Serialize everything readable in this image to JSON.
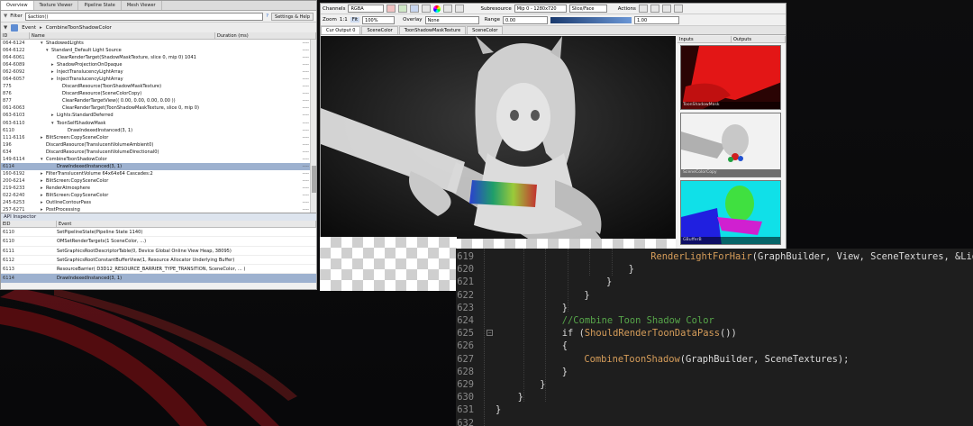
{
  "left_panel": {
    "tabs": [
      "Overview",
      "Texture Viewer",
      "Pipeline State",
      "Mesh Viewer"
    ],
    "filter_label": "Filter",
    "filter_value": "$action()",
    "filter_buttons": [
      "Settings & Help"
    ],
    "bar_label": "Event",
    "bar_text": "CombineToonShadowColor",
    "columns": [
      "ID",
      "Name",
      "Duration (ms)"
    ],
    "events": [
      {
        "id": "064-6124",
        "name": "ShadowedLights",
        "indent": 2,
        "arrow": "▾",
        "dur": "----"
      },
      {
        "id": "064-6122",
        "name": "Standard_Default Light Source",
        "indent": 3,
        "arrow": "▾",
        "dur": "----"
      },
      {
        "id": "064-6061",
        "name": "ClearRenderTarget(ShadowMaskTexture, slice 0, mip 0) 1041",
        "indent": 4,
        "arrow": "",
        "dur": "----"
      },
      {
        "id": "064-6089",
        "name": "ShadowProjectionOnOpaque",
        "indent": 4,
        "arrow": "▸",
        "dur": "----"
      },
      {
        "id": "062-6092",
        "name": "InjectTranslucencyLightArray",
        "indent": 4,
        "arrow": "▸",
        "dur": "----"
      },
      {
        "id": "064-6057",
        "name": "InjectTranslucencyLightArray",
        "indent": 4,
        "arrow": "▸",
        "dur": "----"
      },
      {
        "id": "775",
        "name": "DiscardResource(ToonShadowMaskTexture)",
        "indent": 5,
        "arrow": "",
        "dur": "----"
      },
      {
        "id": "876",
        "name": "DiscardResource(SceneColorCopy)",
        "indent": 5,
        "arrow": "",
        "dur": "----"
      },
      {
        "id": "877",
        "name": "ClearRenderTargetView(( 0.00, 0.00, 0.00, 0.00 ))",
        "indent": 5,
        "arrow": "",
        "dur": "----"
      },
      {
        "id": "061-6063",
        "name": "ClearRenderTarget(ToonShadowMaskTexture, slice 0, mip 0)",
        "indent": 5,
        "arrow": "",
        "dur": "----"
      },
      {
        "id": "063-6103",
        "name": "Lights:StandardDeferred",
        "indent": 4,
        "arrow": "▸",
        "dur": "----"
      },
      {
        "id": "063-6110",
        "name": "ToonSelfShadowMask",
        "indent": 4,
        "arrow": "▾",
        "dur": "----"
      },
      {
        "id": "6110",
        "name": "DrawIndexedInstanced(3, 1)",
        "indent": 6,
        "arrow": "",
        "dur": "----"
      },
      {
        "id": "111-6116",
        "name": "BlitScreen:CopySceneColor",
        "indent": 2,
        "arrow": "▸",
        "dur": "----"
      },
      {
        "id": "196",
        "name": "DiscardResource(TranslucentVolumeAmbient0)",
        "indent": 2,
        "arrow": "",
        "dur": "----"
      },
      {
        "id": "634",
        "name": "DiscardResource(TranslucentVolumeDirectional0)",
        "indent": 2,
        "arrow": "",
        "dur": "----"
      },
      {
        "id": "149-6114",
        "name": "CombineToonShadowColor",
        "indent": 2,
        "arrow": "▾",
        "dur": "----"
      },
      {
        "id": "6114",
        "name": "DrawIndexedInstanced(3, 1)",
        "indent": 4,
        "arrow": "",
        "dur": "----",
        "selected": true
      },
      {
        "id": "160-6192",
        "name": "FilterTranslucentVolume 64x64x64 Cascades:2",
        "indent": 2,
        "arrow": "▸",
        "dur": "----"
      },
      {
        "id": "200-6214",
        "name": "BlitScreen:CopySceneColor",
        "indent": 2,
        "arrow": "▸",
        "dur": "----"
      },
      {
        "id": "219-6233",
        "name": "RenderAtmosphere",
        "indent": 2,
        "arrow": "▸",
        "dur": "----"
      },
      {
        "id": "022-6240",
        "name": "BlitScreen:CopySceneColor",
        "indent": 2,
        "arrow": "▸",
        "dur": "----"
      },
      {
        "id": "245-6253",
        "name": "OutlineContourPass",
        "indent": 2,
        "arrow": "▸",
        "dur": "----"
      },
      {
        "id": "257-6271",
        "name": "PostProcessing",
        "indent": 2,
        "arrow": "▸",
        "dur": "----"
      }
    ],
    "inspector_title": "API Inspector",
    "inspector_columns": [
      "EID",
      "Event"
    ],
    "inspector_rows": [
      {
        "eid": "6110",
        "event": "SetPipelineState(Pipeline State 1140)",
        "selected": false
      },
      {
        "eid": "6110",
        "event": "OMSetRenderTargets(1 SceneColor, ...)",
        "selected": false
      },
      {
        "eid": "6111",
        "event": "SetGraphicsRootDescriptorTable(0, Device Global Online View Heap, 38095)",
        "selected": false
      },
      {
        "eid": "6112",
        "event": "SetGraphicsRootConstantBufferView(1, Resource Allocator Underlying Buffer)",
        "selected": false
      },
      {
        "eid": "6113",
        "event": "ResourceBarrier( D3D12_RESOURCE_BARRIER_TYPE_TRANSITION, SceneColor, ... )",
        "selected": false
      },
      {
        "eid": "6114",
        "event": "DrawIndexedInstanced(3, 1)",
        "selected": true
      }
    ]
  },
  "texture_viewer": {
    "toolbar1": {
      "channels_label": "Channels",
      "channels_value": "RGBA",
      "subresource_label": "Subresource",
      "subresource_value": "Mip 0 - 1280x720",
      "slice_value": "Slice/Face",
      "actions_label": "Actions"
    },
    "toolbar2": {
      "zoom_label": "Zoom",
      "zoom_value": "1:1",
      "fit_label": "Fit",
      "zoom_pct": "100%",
      "overlay_label": "Overlay",
      "overlay_value": "None",
      "range_label": "Range",
      "range_min": "0.00",
      "range_max": "1.00"
    },
    "tabs": [
      "Cur Output 0",
      "SceneColor",
      "ToonShadowMaskTexture",
      "SceneColor"
    ],
    "io_columns": [
      "Inputs",
      "Outputs"
    ],
    "thumbnails": [
      {
        "caption": "ToonShadowMask",
        "kind": "red"
      },
      {
        "caption": "SceneColorCopy",
        "kind": "white"
      },
      {
        "caption": "GBufferB",
        "kind": "cyan"
      }
    ]
  },
  "code_editor": {
    "lines": [
      {
        "num": "619",
        "text": "RenderLightForHair(GraphBuilder, View, SceneTextures, &Light",
        "type": "fn-call",
        "indent": 7
      },
      {
        "num": "620",
        "text": "}",
        "type": "plain",
        "indent": 6
      },
      {
        "num": "621",
        "text": "}",
        "type": "plain",
        "indent": 5
      },
      {
        "num": "622",
        "text": "}",
        "type": "plain",
        "indent": 4
      },
      {
        "num": "623",
        "text": "}",
        "type": "plain",
        "indent": 3
      },
      {
        "num": "624",
        "text": "//Combine Toon Shadow Color",
        "type": "comment",
        "indent": 3
      },
      {
        "num": "625",
        "text": "if (ShouldRenderToonDataPass())",
        "type": "if",
        "indent": 3
      },
      {
        "num": "626",
        "text": "{",
        "type": "plain",
        "indent": 3
      },
      {
        "num": "627",
        "text": "CombineToonShadow(GraphBuilder, SceneTextures);",
        "type": "fn-call2",
        "indent": 4
      },
      {
        "num": "628",
        "text": "}",
        "type": "plain",
        "indent": 3
      },
      {
        "num": "629",
        "text": "}",
        "type": "plain",
        "indent": 2
      },
      {
        "num": "630",
        "text": "}",
        "type": "plain",
        "indent": 1
      },
      {
        "num": "631",
        "text": "}",
        "type": "plain",
        "indent": 0
      },
      {
        "num": "632",
        "text": "",
        "type": "plain",
        "indent": 0
      }
    ]
  }
}
